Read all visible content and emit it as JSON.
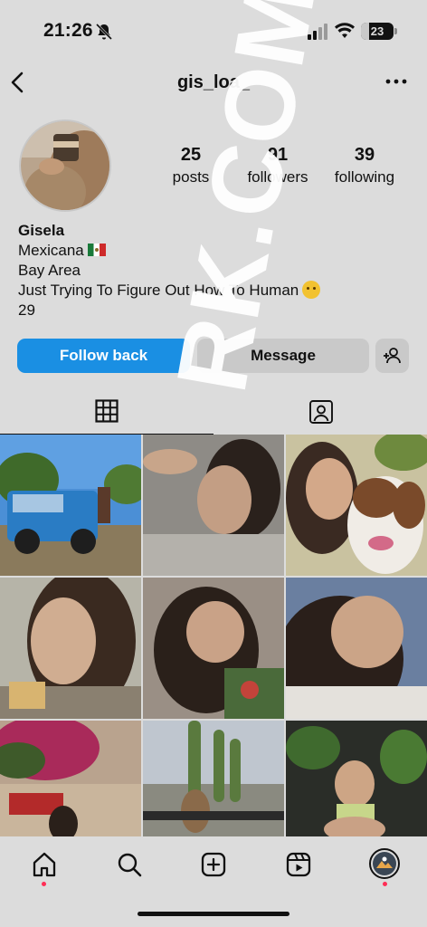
{
  "status": {
    "time": "21:26",
    "battery": "23"
  },
  "header": {
    "username": "gis_loa_"
  },
  "stats": [
    {
      "value": "25",
      "label": "posts"
    },
    {
      "value": "91",
      "label": "followers"
    },
    {
      "value": "39",
      "label": "following"
    }
  ],
  "bio": {
    "name": "Gisela",
    "line1": "Mexicana",
    "line2": "Bay Area",
    "line3": "Just Trying To Figure Out How To Human",
    "line4": "29"
  },
  "actions": {
    "follow": "Follow back",
    "message": "Message"
  },
  "tabs": [
    {
      "icon": "grid-icon",
      "active": true
    },
    {
      "icon": "tagged-icon",
      "active": false
    }
  ],
  "watermark": "RK.COM",
  "nav": [
    "home-icon",
    "search-icon",
    "create-icon",
    "reels-icon",
    "profile-icon"
  ],
  "colors": {
    "accent": "#1a8fe3",
    "background": "#dcdcdc",
    "notification": "#ff2d55"
  }
}
